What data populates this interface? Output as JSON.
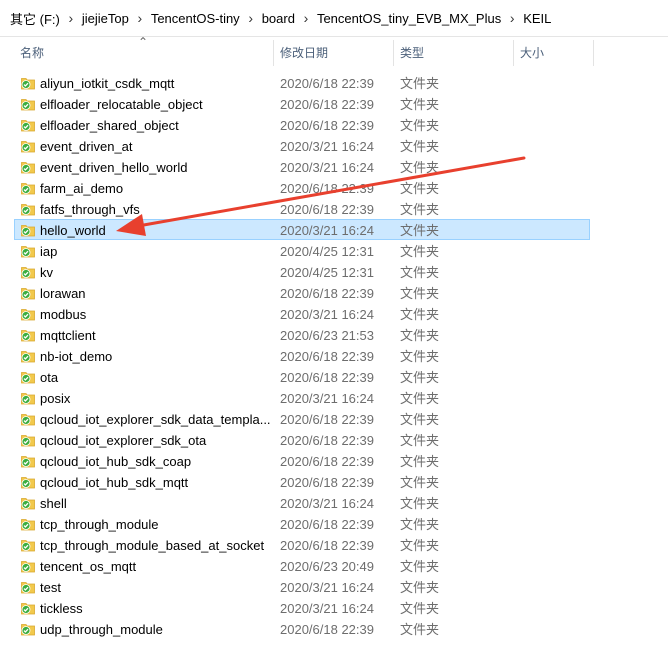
{
  "breadcrumb": [
    "其它 (F:)",
    "jiejieTop",
    "TencentOS-tiny",
    "board",
    "TencentOS_tiny_EVB_MX_Plus",
    "KEIL"
  ],
  "columns": {
    "name": "名称",
    "date": "修改日期",
    "type": "类型",
    "size": "大小"
  },
  "icons": {
    "folder": "folder-icon",
    "annotation": "red-arrow"
  },
  "colors": {
    "selected_bg": "#cce8ff",
    "selected_border": "#99d1ff",
    "arrow": "#e8402e",
    "folder_yellow": "#f2c94c",
    "badge_green": "#3cae3f"
  },
  "files": [
    {
      "name": "aliyun_iotkit_csdk_mqtt",
      "date": "2020/6/18 22:39",
      "type": "文件夹"
    },
    {
      "name": "elfloader_relocatable_object",
      "date": "2020/6/18 22:39",
      "type": "文件夹"
    },
    {
      "name": "elfloader_shared_object",
      "date": "2020/6/18 22:39",
      "type": "文件夹"
    },
    {
      "name": "event_driven_at",
      "date": "2020/3/21 16:24",
      "type": "文件夹"
    },
    {
      "name": "event_driven_hello_world",
      "date": "2020/3/21 16:24",
      "type": "文件夹"
    },
    {
      "name": "farm_ai_demo",
      "date": "2020/6/18 22:39",
      "type": "文件夹"
    },
    {
      "name": "fatfs_through_vfs",
      "date": "2020/6/18 22:39",
      "type": "文件夹"
    },
    {
      "name": "hello_world",
      "date": "2020/3/21 16:24",
      "type": "文件夹",
      "selected": true
    },
    {
      "name": "iap",
      "date": "2020/4/25 12:31",
      "type": "文件夹"
    },
    {
      "name": "kv",
      "date": "2020/4/25 12:31",
      "type": "文件夹"
    },
    {
      "name": "lorawan",
      "date": "2020/6/18 22:39",
      "type": "文件夹"
    },
    {
      "name": "modbus",
      "date": "2020/3/21 16:24",
      "type": "文件夹"
    },
    {
      "name": "mqttclient",
      "date": "2020/6/23 21:53",
      "type": "文件夹"
    },
    {
      "name": "nb-iot_demo",
      "date": "2020/6/18 22:39",
      "type": "文件夹"
    },
    {
      "name": "ota",
      "date": "2020/6/18 22:39",
      "type": "文件夹"
    },
    {
      "name": "posix",
      "date": "2020/3/21 16:24",
      "type": "文件夹"
    },
    {
      "name": "qcloud_iot_explorer_sdk_data_templa...",
      "date": "2020/6/18 22:39",
      "type": "文件夹"
    },
    {
      "name": "qcloud_iot_explorer_sdk_ota",
      "date": "2020/6/18 22:39",
      "type": "文件夹"
    },
    {
      "name": "qcloud_iot_hub_sdk_coap",
      "date": "2020/6/18 22:39",
      "type": "文件夹"
    },
    {
      "name": "qcloud_iot_hub_sdk_mqtt",
      "date": "2020/6/18 22:39",
      "type": "文件夹"
    },
    {
      "name": "shell",
      "date": "2020/3/21 16:24",
      "type": "文件夹"
    },
    {
      "name": "tcp_through_module",
      "date": "2020/6/18 22:39",
      "type": "文件夹"
    },
    {
      "name": "tcp_through_module_based_at_socket",
      "date": "2020/6/18 22:39",
      "type": "文件夹"
    },
    {
      "name": "tencent_os_mqtt",
      "date": "2020/6/23 20:49",
      "type": "文件夹"
    },
    {
      "name": "test",
      "date": "2020/3/21 16:24",
      "type": "文件夹"
    },
    {
      "name": "tickless",
      "date": "2020/3/21 16:24",
      "type": "文件夹"
    },
    {
      "name": "udp_through_module",
      "date": "2020/6/18 22:39",
      "type": "文件夹"
    }
  ]
}
